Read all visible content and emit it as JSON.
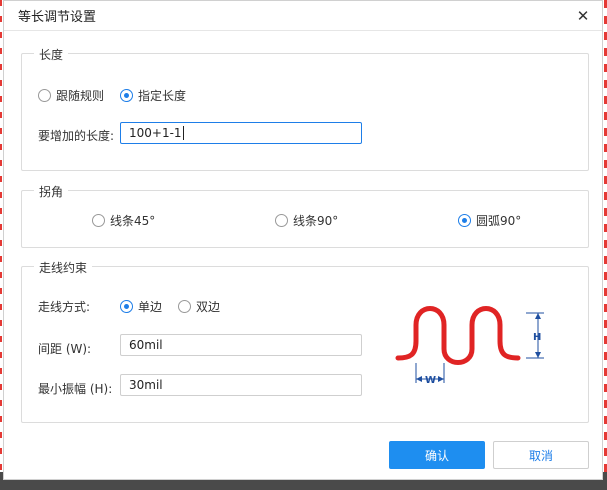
{
  "dialog": {
    "title": "等长调节设置",
    "close_icon": "close-icon"
  },
  "length_group": {
    "legend": "长度",
    "options": [
      {
        "label": "跟随规则",
        "checked": false
      },
      {
        "label": "指定长度",
        "checked": true
      }
    ],
    "increase_label": "要增加的长度:",
    "increase_value": "100+1-1"
  },
  "corner_group": {
    "legend": "拐角",
    "options": [
      {
        "label": "线条45°",
        "checked": false
      },
      {
        "label": "线条90°",
        "checked": false
      },
      {
        "label": "圆弧90°",
        "checked": true
      }
    ]
  },
  "routing_group": {
    "legend": "走线约束",
    "mode_label": "走线方式:",
    "mode_options": [
      {
        "label": "单边",
        "checked": true
      },
      {
        "label": "双边",
        "checked": false
      }
    ],
    "spacing_label": "间距 (W):",
    "spacing_value": "60mil",
    "amplitude_label": "最小振幅 (H):",
    "amplitude_value": "30mil",
    "diagram": {
      "w_label": "W",
      "h_label": "H",
      "trace_color": "#e02424",
      "dimension_color": "#1f4fa0"
    }
  },
  "buttons": {
    "confirm": "确认",
    "cancel": "取消"
  }
}
